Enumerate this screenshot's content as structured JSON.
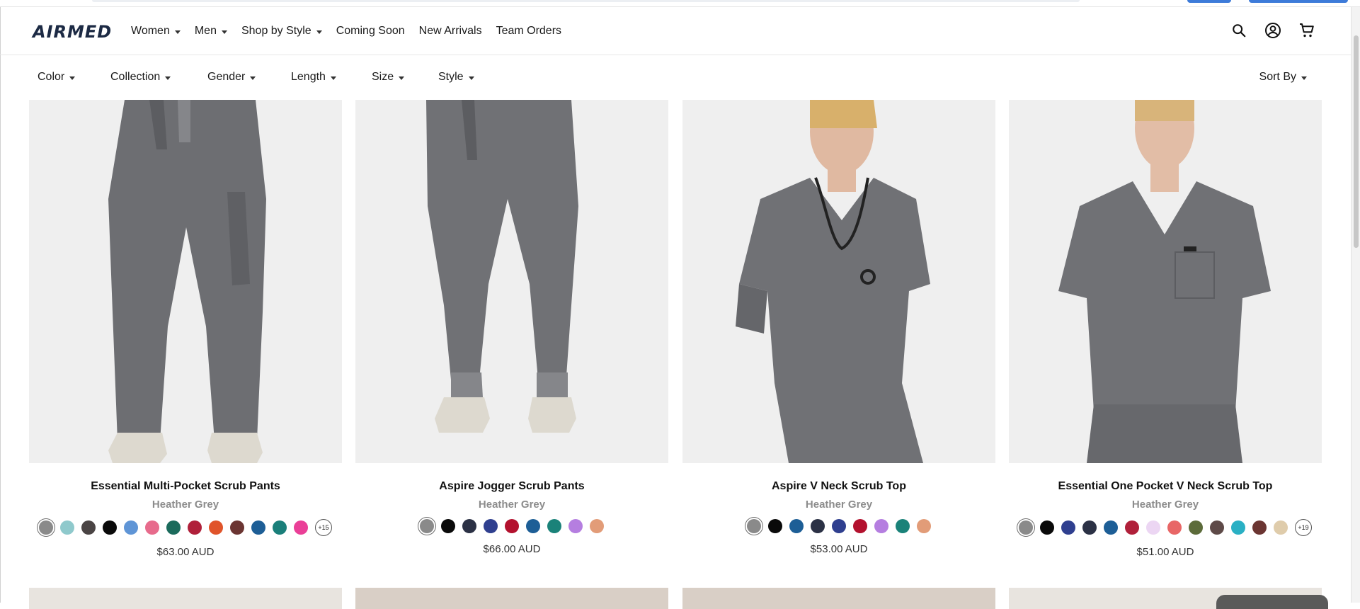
{
  "brand": {
    "logo": "AIRMED"
  },
  "nav": {
    "items": [
      {
        "label": "Women",
        "dropdown": true
      },
      {
        "label": "Men",
        "dropdown": true
      },
      {
        "label": "Shop by Style",
        "dropdown": true
      },
      {
        "label": "Coming Soon",
        "dropdown": false
      },
      {
        "label": "New Arrivals",
        "dropdown": false
      },
      {
        "label": "Team Orders",
        "dropdown": false
      }
    ]
  },
  "header_icons": [
    "search-icon",
    "account-icon",
    "cart-icon"
  ],
  "filters": {
    "items": [
      "Color",
      "Collection",
      "Gender",
      "Length",
      "Size",
      "Style"
    ],
    "sort_label": "Sort By"
  },
  "products": [
    {
      "title": "Essential Multi-Pocket Scrub Pants",
      "color": "Heather Grey",
      "price": "$63.00 AUD",
      "swatches": [
        "#8a8a8a",
        "#8fc9cc",
        "#4a4444",
        "#0a0a0a",
        "#5f95d6",
        "#e76b8c",
        "#1b6b5c",
        "#b0203a",
        "#e0542a",
        "#6b3532",
        "#1d5e96",
        "#1a7f7a",
        "#ea3f97"
      ],
      "more": "+15"
    },
    {
      "title": "Aspire Jogger Scrub Pants",
      "color": "Heather Grey",
      "price": "$66.00 AUD",
      "swatches": [
        "#8a8a8a",
        "#0a0a0a",
        "#2b3145",
        "#2f3f8f",
        "#b3112e",
        "#1d5e96",
        "#1a8279",
        "#b57ee0",
        "#e29c78"
      ],
      "more": ""
    },
    {
      "title": "Aspire V Neck Scrub Top",
      "color": "Heather Grey",
      "price": "$53.00 AUD",
      "swatches": [
        "#8a8a8a",
        "#0a0a0a",
        "#1d5e96",
        "#2b3145",
        "#2f3f8f",
        "#b3112e",
        "#b57ee0",
        "#1a8279",
        "#e29c78"
      ],
      "more": ""
    },
    {
      "title": "Essential One Pocket V Neck Scrub Top",
      "color": "Heather Grey",
      "price": "$51.00 AUD",
      "swatches": [
        "#8a8a8a",
        "#0a0a0a",
        "#2f3f8f",
        "#2b3145",
        "#1d5e96",
        "#b0203a",
        "#ecd6f3",
        "#e86666",
        "#5c6b3a",
        "#5e4a48",
        "#2ab0c4",
        "#6b3532",
        "#dfccab"
      ],
      "more": "+19"
    }
  ]
}
